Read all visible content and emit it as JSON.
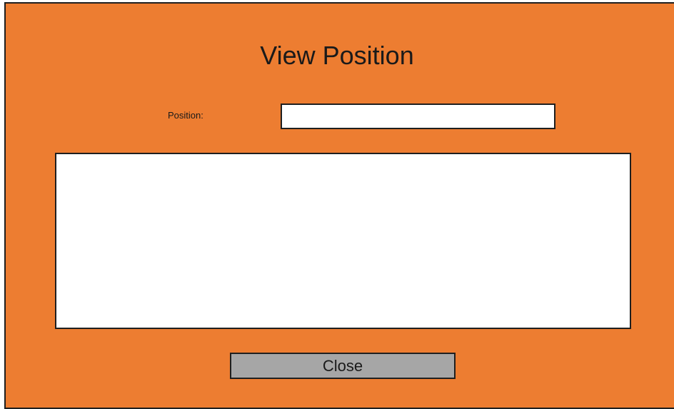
{
  "window": {
    "title": "View Position"
  },
  "form": {
    "position_label": "Position:",
    "position_value": "",
    "position_placeholder": "",
    "details_value": ""
  },
  "actions": {
    "close_label": "Close"
  },
  "colors": {
    "background": "#ED7D31",
    "button": "#A6A6A6",
    "field": "#FFFFFF",
    "border": "#1F1F1F"
  }
}
